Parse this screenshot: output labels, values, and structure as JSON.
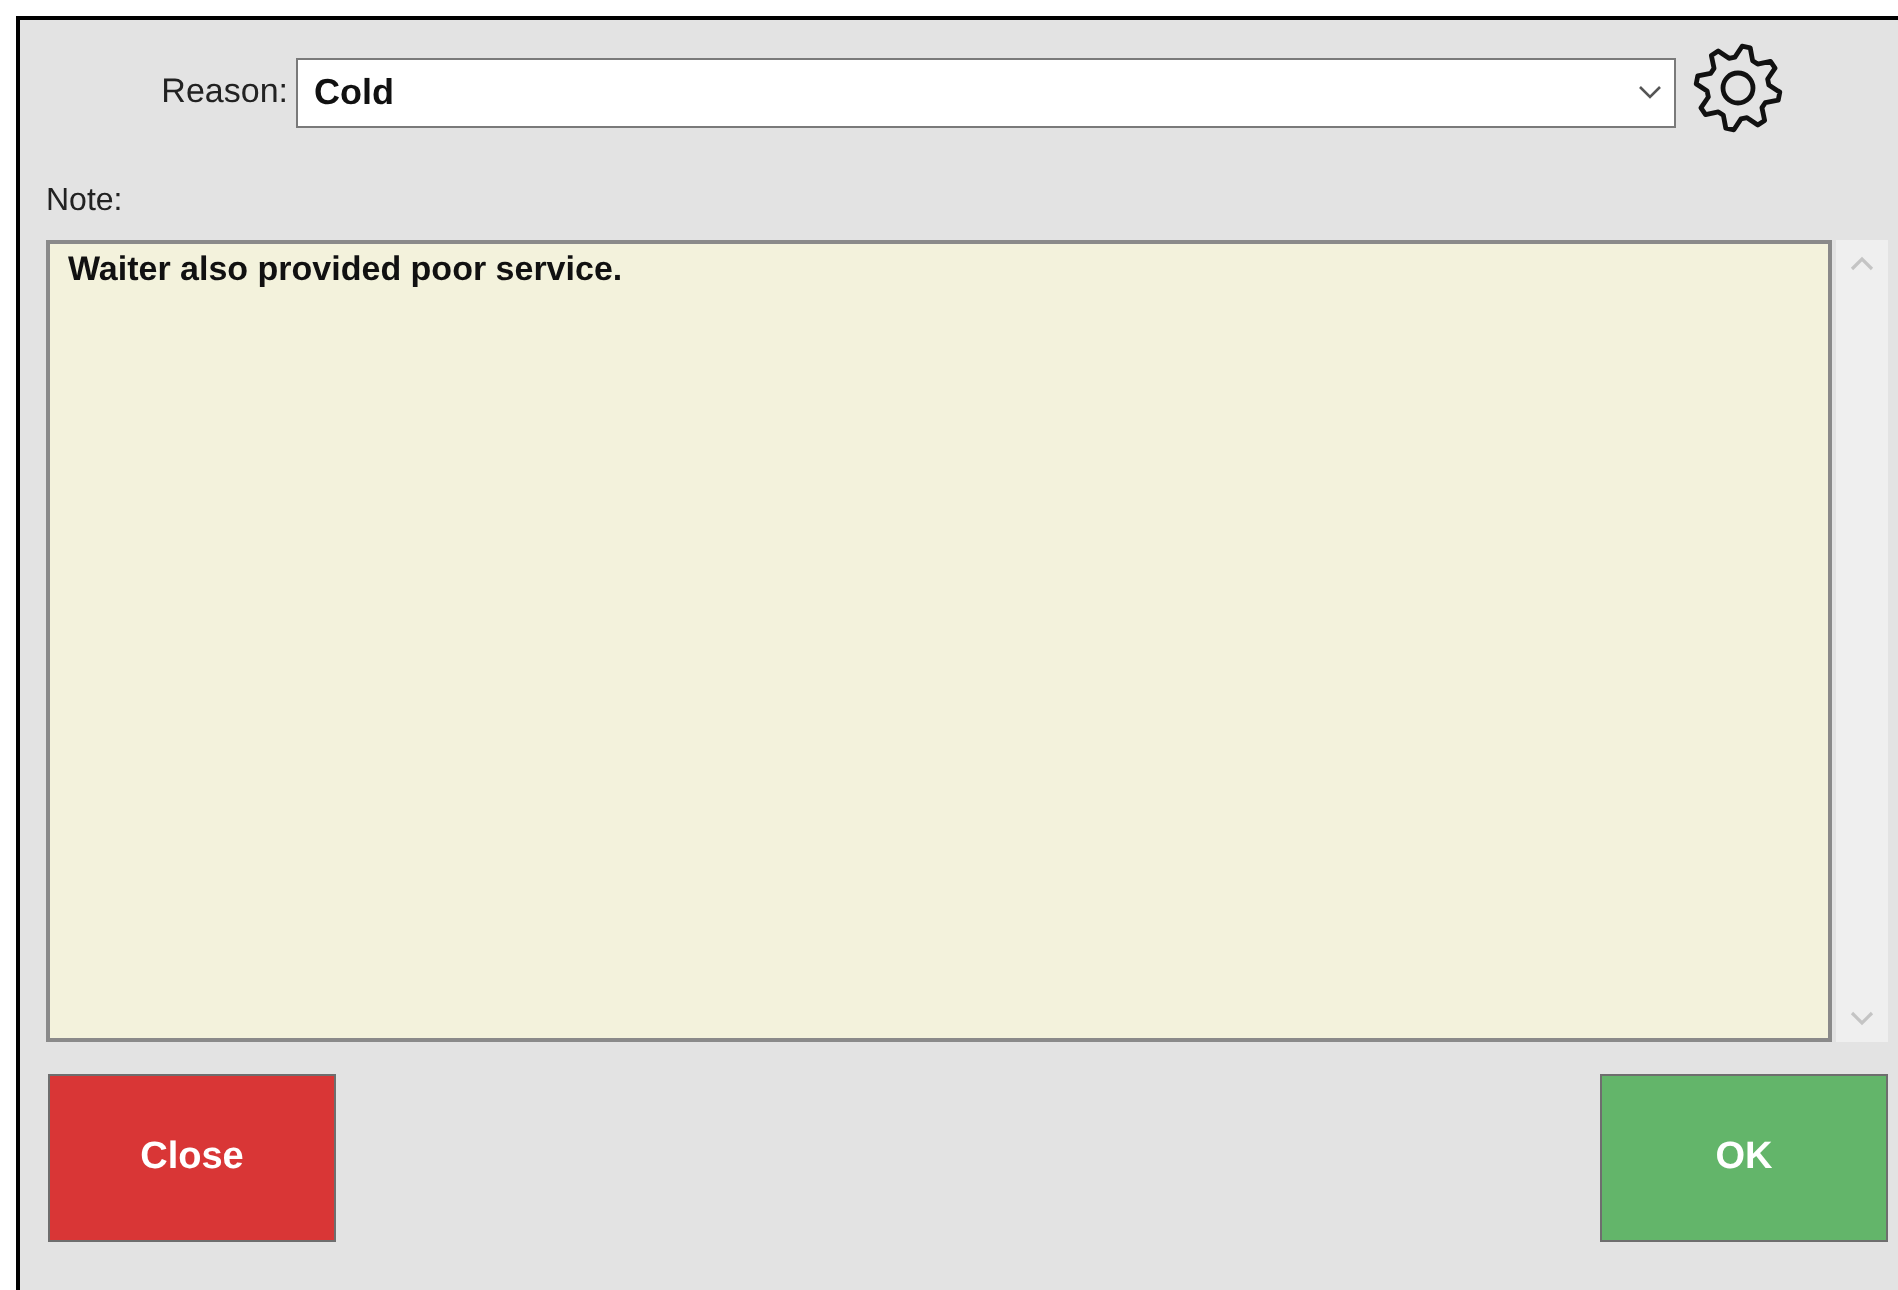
{
  "reason": {
    "label": "Reason:",
    "value": "Cold"
  },
  "note": {
    "label": "Note:",
    "value": "Waiter also provided poor service."
  },
  "buttons": [
    {
      "label": "Close",
      "kind": "cancel"
    },
    {
      "label": "OK",
      "kind": "confirm"
    }
  ]
}
